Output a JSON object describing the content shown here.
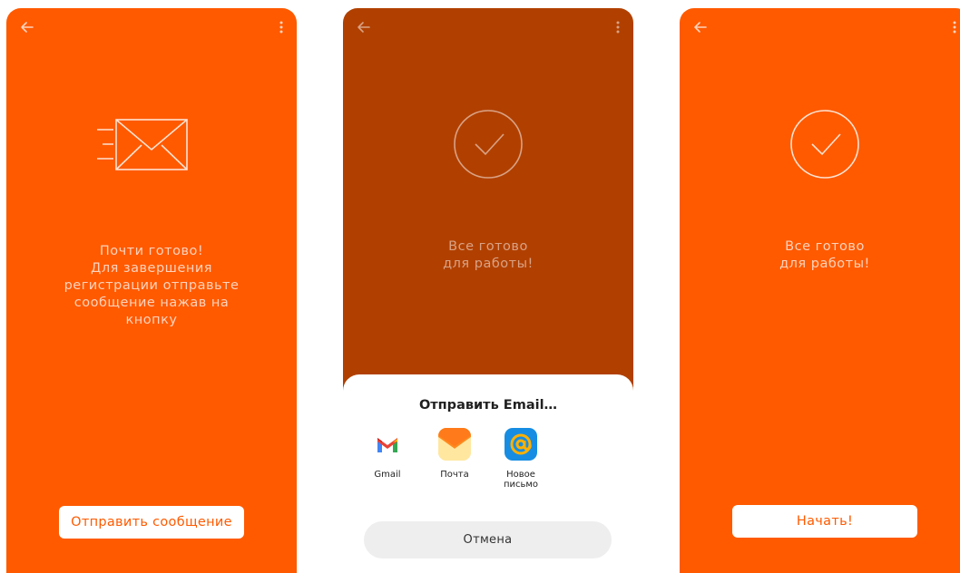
{
  "screens": [
    {
      "id": "almost-done",
      "background": "#ff5a00",
      "message_lines": [
        "Почти готово!",
        "Для завершения",
        "регистрации отправьте",
        "сообщение нажав на",
        "кнопку"
      ],
      "button_label": "Отправить сообщение",
      "icons": [
        "back-arrow-icon",
        "more-vert-icon",
        "mail-send-icon"
      ]
    },
    {
      "id": "share-sheet",
      "background": "#b14000",
      "message_lines": [
        "Все готово",
        "для работы!"
      ],
      "sheet": {
        "title": "Отправить Email…",
        "apps": [
          {
            "label": "Gmail",
            "icon": "gmail-icon"
          },
          {
            "label": "Почта",
            "icon": "mail-app-icon"
          },
          {
            "label": "Новое письмо",
            "icon": "mailru-icon"
          }
        ],
        "cancel_label": "Отмена"
      },
      "icons": [
        "back-arrow-icon",
        "more-vert-icon",
        "check-circle-icon"
      ]
    },
    {
      "id": "all-done",
      "background": "#ff5a00",
      "message_lines": [
        "Все готово",
        "для работы!"
      ],
      "button_label": "Начать!",
      "icons": [
        "back-arrow-icon",
        "more-vert-icon",
        "check-circle-icon"
      ]
    }
  ],
  "colors": {
    "accent": "#ff5a00",
    "dimmed": "#b14000",
    "text_light": "#ffd3bd"
  }
}
